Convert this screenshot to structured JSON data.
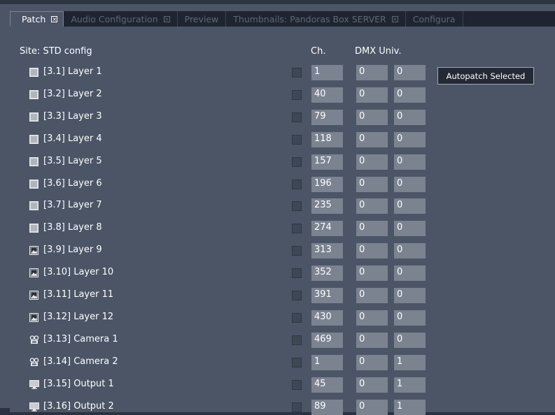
{
  "tabs": [
    {
      "label": "Patch",
      "active": true
    },
    {
      "label": "Audio Configuration"
    },
    {
      "label": "Preview",
      "no_close": true
    },
    {
      "label": "Thumbnails: Pandoras Box SERVER"
    },
    {
      "label": "Configura",
      "no_close": true
    }
  ],
  "site_label": "Site: STD config",
  "headers": {
    "ch": "Ch.",
    "dmx": "DMX Univ."
  },
  "autopatch_label": "Autopatch Selected",
  "rows": [
    {
      "label": "[3.1] Layer 1",
      "icon": "layer-icon",
      "ch": "1",
      "dmx1": "0",
      "dmx2": "0"
    },
    {
      "label": "[3.2] Layer 2",
      "icon": "layer-icon",
      "ch": "40",
      "dmx1": "0",
      "dmx2": "0"
    },
    {
      "label": "[3.3] Layer 3",
      "icon": "layer-icon",
      "ch": "79",
      "dmx1": "0",
      "dmx2": "0"
    },
    {
      "label": "[3.4] Layer 4",
      "icon": "layer-icon",
      "ch": "118",
      "dmx1": "0",
      "dmx2": "0"
    },
    {
      "label": "[3.5] Layer 5",
      "icon": "layer-icon",
      "ch": "157",
      "dmx1": "0",
      "dmx2": "0"
    },
    {
      "label": "[3.6] Layer 6",
      "icon": "layer-icon",
      "ch": "196",
      "dmx1": "0",
      "dmx2": "0"
    },
    {
      "label": "[3.7] Layer 7",
      "icon": "layer-icon",
      "ch": "235",
      "dmx1": "0",
      "dmx2": "0"
    },
    {
      "label": "[3.8] Layer 8",
      "icon": "layer-icon",
      "ch": "274",
      "dmx1": "0",
      "dmx2": "0"
    },
    {
      "label": "[3.9] Layer 9",
      "icon": "image-layer-icon",
      "ch": "313",
      "dmx1": "0",
      "dmx2": "0"
    },
    {
      "label": "[3.10] Layer 10",
      "icon": "image-layer-icon",
      "ch": "352",
      "dmx1": "0",
      "dmx2": "0"
    },
    {
      "label": "[3.11] Layer 11",
      "icon": "image-layer-icon",
      "ch": "391",
      "dmx1": "0",
      "dmx2": "0"
    },
    {
      "label": "[3.12] Layer 12",
      "icon": "image-layer-icon",
      "ch": "430",
      "dmx1": "0",
      "dmx2": "0"
    },
    {
      "label": "[3.13] Camera 1",
      "icon": "camera-icon",
      "ch": "469",
      "dmx1": "0",
      "dmx2": "0"
    },
    {
      "label": "[3.14] Camera 2",
      "icon": "camera-icon",
      "ch": "1",
      "dmx1": "0",
      "dmx2": "1"
    },
    {
      "label": "[3.15] Output 1",
      "icon": "monitor-icon",
      "ch": "45",
      "dmx1": "0",
      "dmx2": "1"
    },
    {
      "label": "[3.16] Output 2",
      "icon": "monitor-icon",
      "ch": "89",
      "dmx1": "0",
      "dmx2": "1"
    }
  ]
}
